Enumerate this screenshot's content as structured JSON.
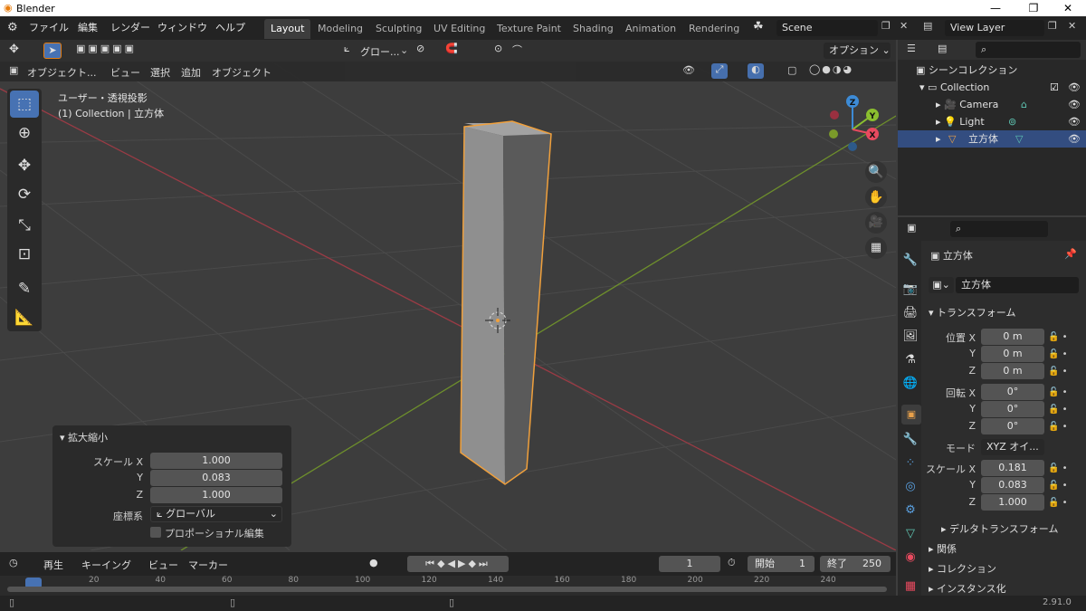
{
  "window": {
    "title": "Blender"
  },
  "menus": [
    "ファイル",
    "編集",
    "レンダー",
    "ウィンドウ",
    "ヘルプ"
  ],
  "workspaces": [
    "Layout",
    "Modeling",
    "Sculpting",
    "UV Editing",
    "Texture Paint",
    "Shading",
    "Animation",
    "Rendering"
  ],
  "scene": "Scene",
  "view_layer": "View Layer",
  "toolheader": {
    "orientation": "グロー...",
    "options": "オプション"
  },
  "viewport_header": {
    "mode": "オブジェクト...",
    "menus": [
      "ビュー",
      "選択",
      "追加",
      "オブジェクト"
    ]
  },
  "viewport": {
    "view_name": "ユーザー・透視投影",
    "collection_info": "(1) Collection | 立方体"
  },
  "gizmo": {
    "x": "X",
    "y": "Y",
    "z": "Z"
  },
  "redo_panel": {
    "title": "拡大縮小",
    "scale_label": "スケール X",
    "y_label": "Y",
    "z_label": "Z",
    "scale_x": "1.000",
    "scale_y": "0.083",
    "scale_z": "1.000",
    "orient_label": "座標系",
    "orient_value": "グローバル",
    "proportional": "プロポーショナル編集"
  },
  "outliner": {
    "scene_collection": "シーンコレクション",
    "items": [
      {
        "label": "Collection"
      },
      {
        "label": "Camera"
      },
      {
        "label": "Light"
      },
      {
        "label": "立方体"
      }
    ]
  },
  "properties": {
    "object_name": "立方体",
    "data_name": "立方体",
    "transform_title": "トランスフォーム",
    "location_label": "位置 X",
    "rotation_label": "回転 X",
    "mode_label": "モード",
    "mode_value": "XYZ オイ...",
    "scale_label": "スケール X",
    "y": "Y",
    "z": "Z",
    "location": [
      "0 m",
      "0 m",
      "0 m"
    ],
    "rotation": [
      "0°",
      "0°",
      "0°"
    ],
    "scale": [
      "0.181",
      "0.083",
      "1.000"
    ],
    "sections": [
      "デルタトランスフォーム",
      "関係",
      "コレクション",
      "インスタンス化"
    ]
  },
  "timeline": {
    "menus": [
      "再生",
      "キーイング",
      "ビュー",
      "マーカー"
    ],
    "current_frame": "1",
    "start_label": "開始",
    "start": "1",
    "end_label": "終了",
    "end": "250",
    "ticks": [
      "20",
      "40",
      "60",
      "80",
      "100",
      "120",
      "140",
      "160",
      "180",
      "200",
      "220",
      "240"
    ]
  },
  "status": {
    "version": "2.91.0"
  },
  "colors": {
    "accent": "#4772b3",
    "selection": "#f0a03c",
    "x_axis": "#e84a5f",
    "y_axis": "#8bbf2f",
    "z_axis": "#3d8bd6"
  }
}
